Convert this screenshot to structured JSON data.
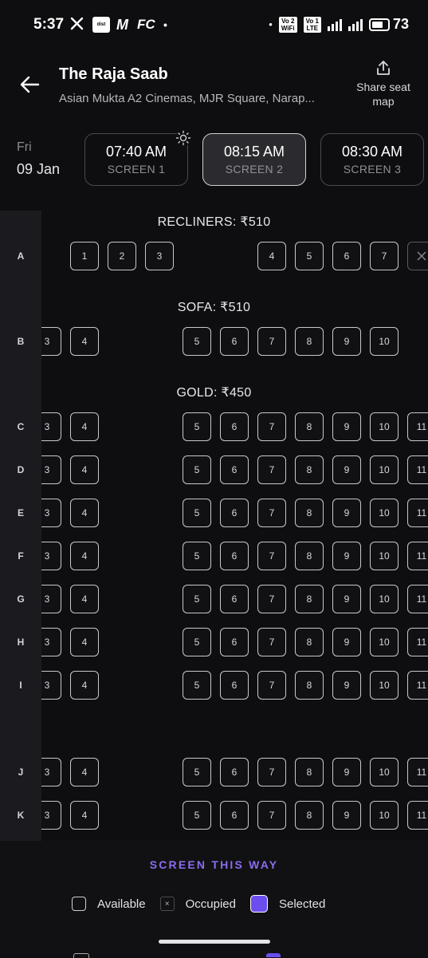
{
  "status_bar": {
    "time": "5:37",
    "apps": [
      "X",
      "district",
      "M",
      "FC"
    ],
    "net1": "Vo 2 WiFi",
    "net2": "Vo 1 LTE",
    "battery": "73"
  },
  "header": {
    "title": "The Raja Saab",
    "venue": "Asian Mukta A2 Cinemas, MJR Square, Narap...",
    "share_label": "Share seat map"
  },
  "date": {
    "day": "Fri",
    "date": "09 Jan"
  },
  "showtimes": [
    {
      "time": "07:40 AM",
      "screen": "SCREEN 1",
      "selected": false
    },
    {
      "time": "08:15 AM",
      "screen": "SCREEN 2",
      "selected": true
    },
    {
      "time": "08:30 AM",
      "screen": "SCREEN 3",
      "selected": false
    }
  ],
  "sections": [
    {
      "label": "RECLINERS: ₹510"
    },
    {
      "label": "SOFA: ₹510"
    },
    {
      "label": "GOLD: ₹450"
    }
  ],
  "rows": [
    {
      "letter": "A",
      "seats": [
        "1",
        "2",
        "3",
        "4",
        "5",
        "6",
        "7"
      ]
    },
    {
      "letter": "B",
      "seats": [
        "3",
        "4",
        "5",
        "6",
        "7",
        "8",
        "9",
        "10"
      ]
    },
    {
      "letter": "C",
      "seats": [
        "3",
        "4",
        "5",
        "6",
        "7",
        "8",
        "9",
        "10",
        "11"
      ]
    },
    {
      "letter": "D",
      "seats": [
        "3",
        "4",
        "5",
        "6",
        "7",
        "8",
        "9",
        "10",
        "11"
      ]
    },
    {
      "letter": "E",
      "seats": [
        "3",
        "4",
        "5",
        "6",
        "7",
        "8",
        "9",
        "10",
        "11"
      ]
    },
    {
      "letter": "F",
      "seats": [
        "3",
        "4",
        "5",
        "6",
        "7",
        "8",
        "9",
        "10",
        "11"
      ]
    },
    {
      "letter": "G",
      "seats": [
        "3",
        "4",
        "5",
        "6",
        "7",
        "8",
        "9",
        "10",
        "11"
      ]
    },
    {
      "letter": "H",
      "seats": [
        "3",
        "4",
        "5",
        "6",
        "7",
        "8",
        "9",
        "10",
        "11"
      ]
    },
    {
      "letter": "I",
      "seats": [
        "3",
        "4",
        "5",
        "6",
        "7",
        "8",
        "9",
        "10",
        "11"
      ]
    },
    {
      "letter": "J",
      "seats": [
        "3",
        "4",
        "5",
        "6",
        "7",
        "8",
        "9",
        "10",
        "11"
      ]
    },
    {
      "letter": "K",
      "seats": [
        "3",
        "4",
        "5",
        "6",
        "7",
        "8",
        "9",
        "10",
        "11"
      ]
    }
  ],
  "bottom": {
    "screen_label": "SCREEN THIS WAY",
    "legend_available": "Available",
    "legend_occupied": "Occupied",
    "legend_selected": "Selected"
  },
  "colors": {
    "accent": "#6c4df0",
    "background": "#0e0e10",
    "screen_label": "#8b6cf0"
  }
}
